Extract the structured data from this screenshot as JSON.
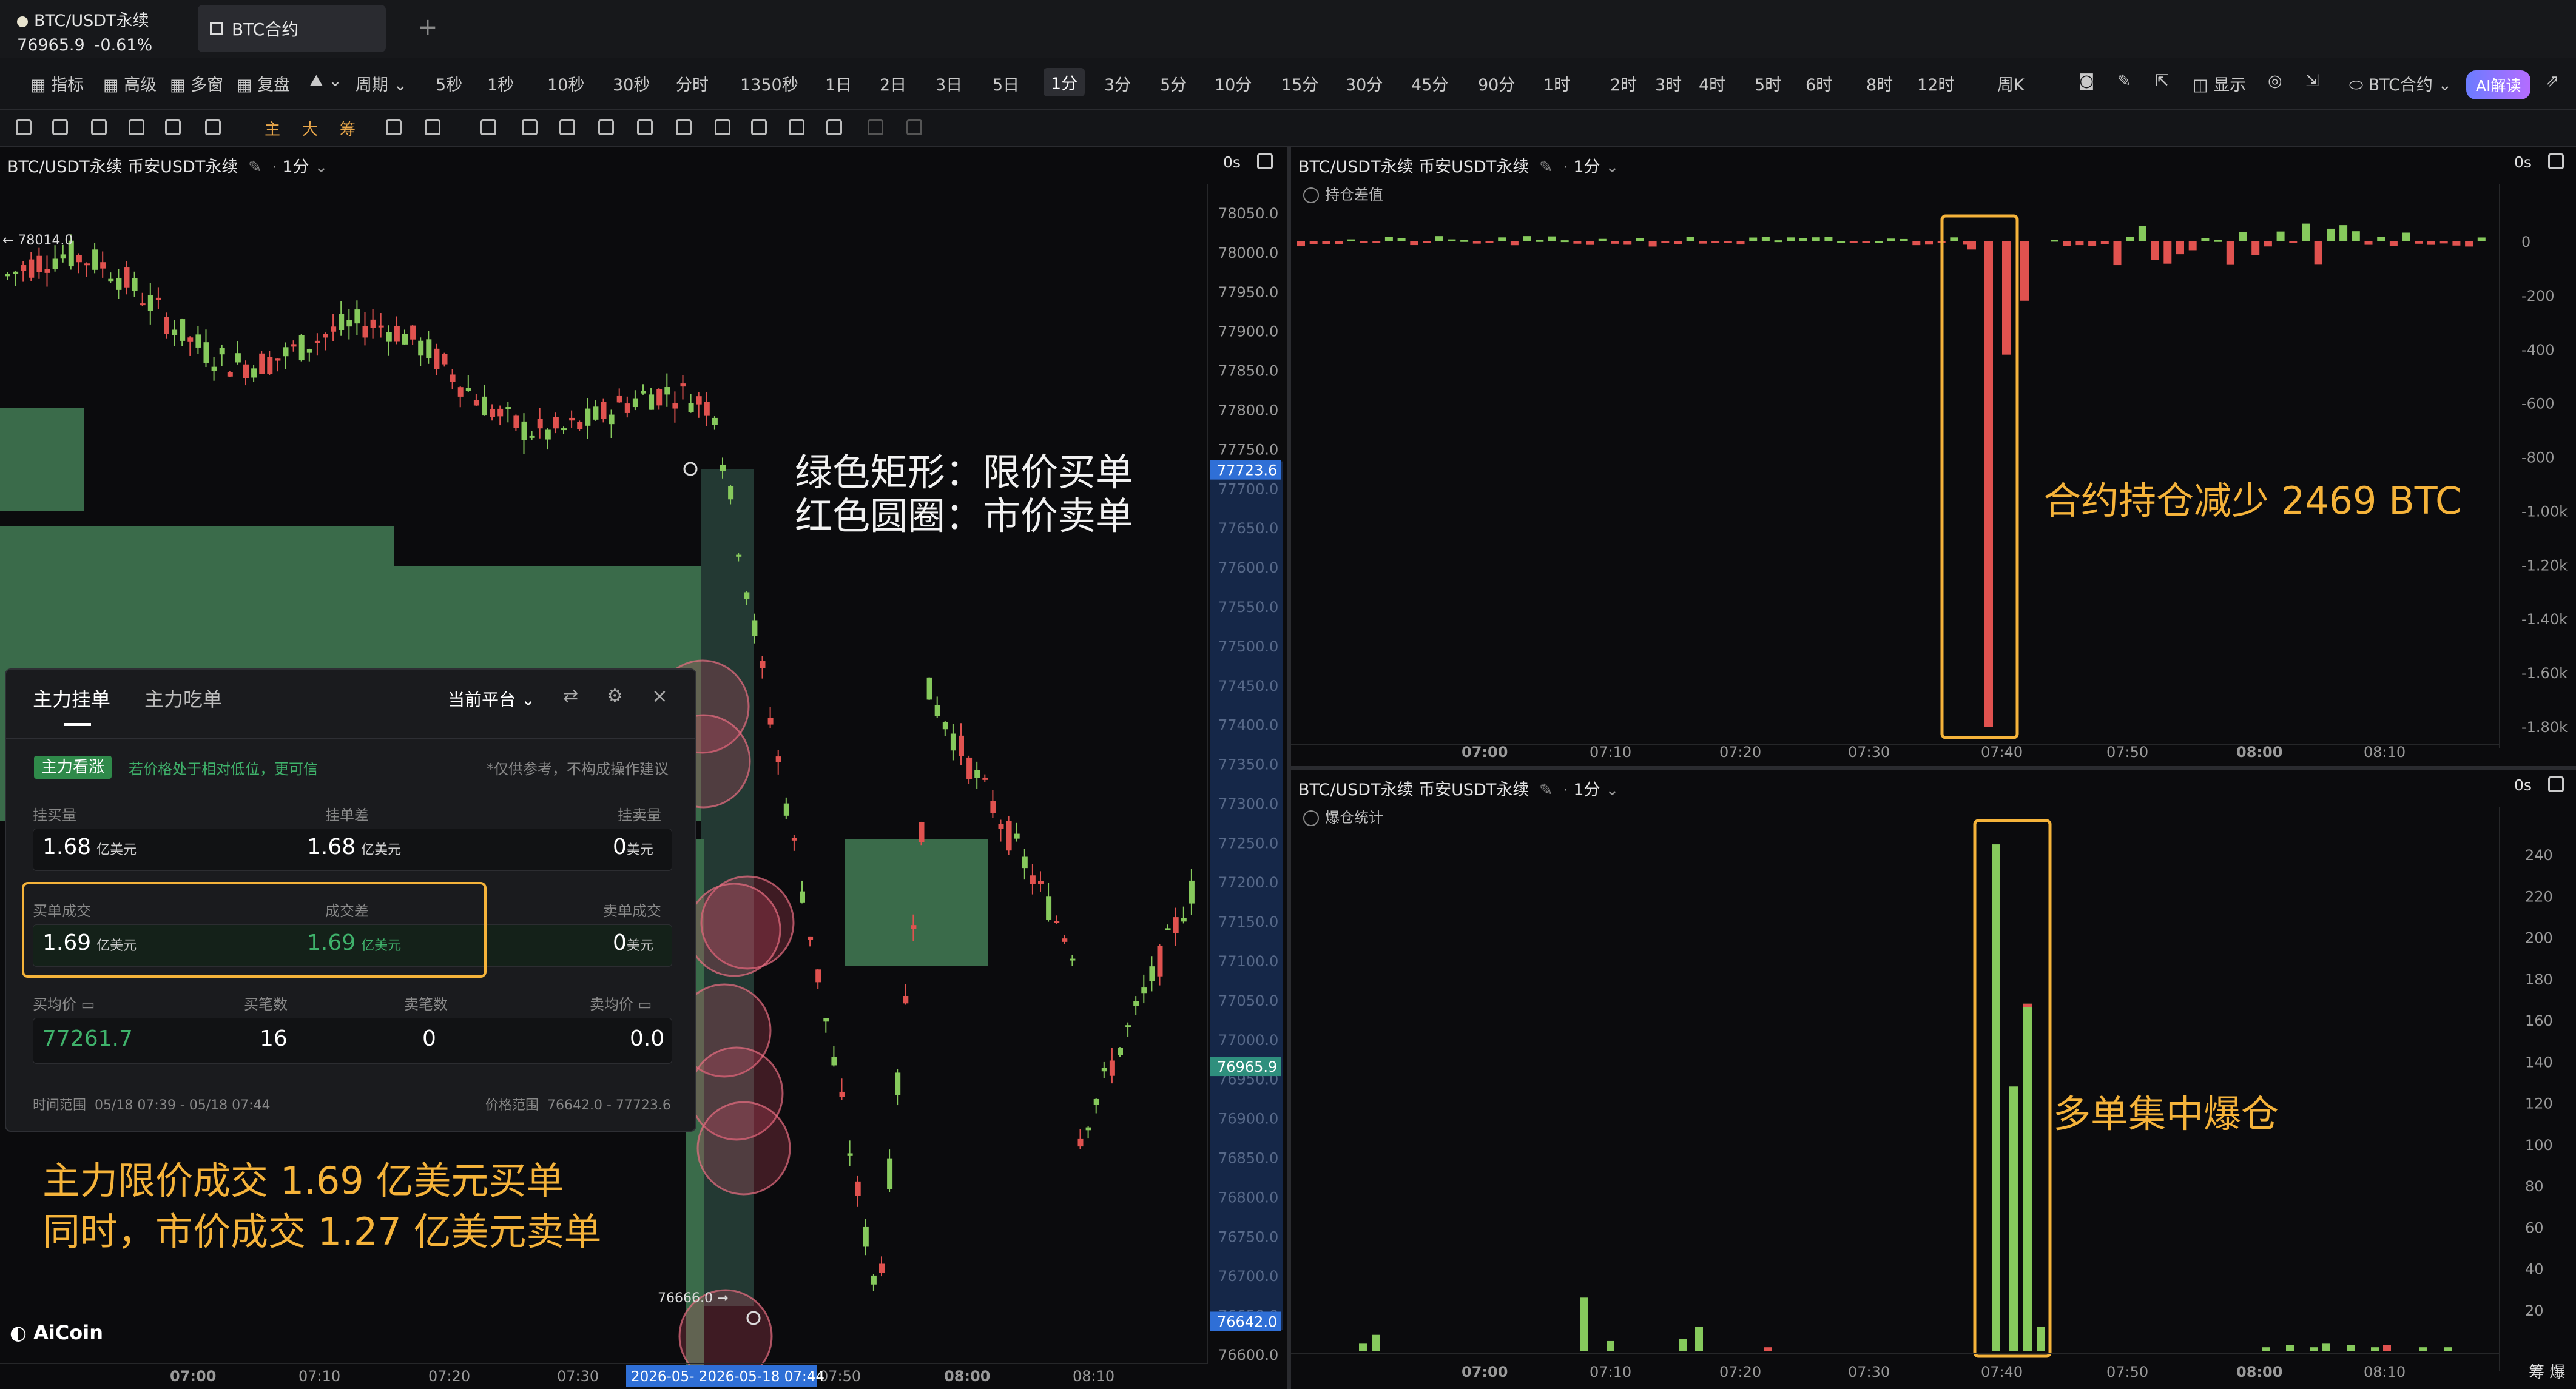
{
  "header": {
    "symbol": "BTC/USDT永续",
    "price": "76965.9",
    "change": "-0.61%",
    "tab": "BTC合约"
  },
  "toolbar": {
    "items": [
      "指标",
      "高级",
      "多窗",
      "复盘"
    ],
    "period_label": "周期",
    "intervals": [
      "5秒",
      "1秒",
      "10秒",
      "30秒",
      "分时",
      "1350秒",
      "1日",
      "2日",
      "3日",
      "5日",
      "1分",
      "3分",
      "5分",
      "10分",
      "15分",
      "30分",
      "45分",
      "90分",
      "1时",
      "2时",
      "3时",
      "4时",
      "5时",
      "6时",
      "8时",
      "12时",
      "周K"
    ],
    "selected_interval": "1分",
    "display": "显示",
    "contract": "BTC合约",
    "ai": "AI解读"
  },
  "colors": {
    "up": "#86c95c",
    "down": "#e0524f",
    "limit_buy": "#3d6f4d",
    "accent": "#f5b33a",
    "price_tag": "#2f6fd6"
  },
  "main_chart": {
    "title": "BTC/USDT永续 币安USDT永续",
    "interval": "1分",
    "countdown": "0s",
    "high_label": "78014.0",
    "low_label": "76666.0",
    "price_axis": [
      "78050.0",
      "78000.0",
      "77950.0",
      "77900.0",
      "77850.0",
      "77800.0",
      "77750.0",
      "77700.0",
      "77650.0",
      "77600.0",
      "77550.0",
      "77500.0",
      "77450.0",
      "77400.0",
      "77350.0",
      "77300.0",
      "77250.0",
      "77200.0",
      "77150.0",
      "77100.0",
      "77050.0",
      "77000.0",
      "76950.0",
      "76900.0",
      "76850.0",
      "76800.0",
      "76750.0",
      "76700.0",
      "76650.0",
      "76600.0"
    ],
    "tag_top": "77723.6",
    "tag_current": "76965.9",
    "tag_bottom": "76642.0",
    "time_axis": [
      "07:00",
      "07:10",
      "07:20",
      "07:30",
      "07:50",
      "08:00",
      "08:10"
    ],
    "time_highlight": "2026-05-  2026-05-18 07:44"
  },
  "annotations": {
    "legend_line1": "绿色矩形：限价买单",
    "legend_line2": "红色圆圈：市价卖单",
    "summary_line1": "主力限价成交 1.69 亿美元买单",
    "summary_line2": "同时，市价成交 1.27 亿美元卖单",
    "oi_note": "合约持仓减少 2469 BTC",
    "liq_note": "多单集中爆仓"
  },
  "order_panel": {
    "tab_active": "主力挂单",
    "tab_other": "主力吃单",
    "platform": "当前平台",
    "badge": "主力看涨",
    "hint": "若价格处于相对低位，更可信",
    "disclaimer": "*仅供参考，不构成操作建议",
    "row1_labels": [
      "挂买量",
      "挂单差",
      "挂卖量"
    ],
    "row1_values": [
      {
        "v": "1.68",
        "u": "亿美元"
      },
      {
        "v": "1.68",
        "u": "亿美元"
      },
      {
        "v": "0",
        "u": "美元"
      }
    ],
    "row2_labels": [
      "买单成交",
      "成交差",
      "卖单成交"
    ],
    "row2_values": [
      {
        "v": "1.69",
        "u": "亿美元"
      },
      {
        "v": "1.69",
        "u": "亿美元"
      },
      {
        "v": "0",
        "u": "美元"
      }
    ],
    "row3_labels": [
      "买均价",
      "买笔数",
      "卖笔数",
      "卖均价"
    ],
    "row3_values": [
      "77261.7",
      "16",
      "0",
      "0.0"
    ],
    "time_range_label": "时间范围",
    "time_range": "05/18 07:39 - 05/18 07:44",
    "price_range_label": "价格范围",
    "price_range": "76642.0 - 77723.6"
  },
  "oi_chart": {
    "title": "BTC/USDT永续 币安USDT永续",
    "interval": "1分",
    "countdown": "0s",
    "indicator": "持仓差值",
    "y_axis": [
      "0",
      "-200",
      "-400",
      "-600",
      "-800",
      "-1.00k",
      "-1.20k",
      "-1.40k",
      "-1.60k",
      "-1.80k"
    ],
    "time_axis": [
      "07:00",
      "07:10",
      "07:20",
      "07:30",
      "07:40",
      "07:50",
      "08:00",
      "08:10"
    ]
  },
  "liq_chart": {
    "title": "BTC/USDT永续 币安USDT永续",
    "interval": "1分",
    "countdown": "0s",
    "indicator": "爆仓统计",
    "y_axis": [
      "240",
      "220",
      "200",
      "180",
      "160",
      "140",
      "120",
      "100",
      "80",
      "60",
      "40",
      "20"
    ],
    "time_axis": [
      "07:00",
      "07:10",
      "07:20",
      "07:30",
      "07:40",
      "07:50",
      "08:00",
      "08:10"
    ],
    "footer": [
      "筹",
      "爆"
    ]
  },
  "chart_data": [
    {
      "type": "bar",
      "title": "持仓差值",
      "x": [
        "07:40",
        "07:41",
        "07:42",
        "07:43"
      ],
      "values": [
        -30,
        -1800,
        -420,
        -220
      ],
      "ylim": [
        -1850,
        60
      ]
    },
    {
      "type": "bar",
      "title": "爆仓统计",
      "x": [
        "07:40",
        "07:41",
        "07:42",
        "07:43"
      ],
      "values": [
        245,
        128,
        168,
        12
      ],
      "ylim": [
        0,
        250
      ]
    }
  ],
  "logo": "AiCoin"
}
